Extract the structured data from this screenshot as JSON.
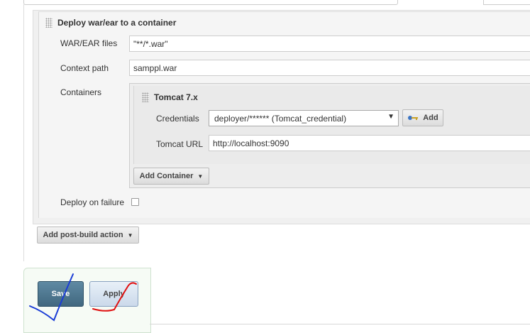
{
  "deploy": {
    "title": "Deploy war/ear to a container",
    "war_label": "WAR/EAR files",
    "war_value": "\"**/*.war\"",
    "context_label": "Context path",
    "context_value": "samppl.war",
    "containers_label": "Containers",
    "deploy_failure_label": "Deploy on failure",
    "deploy_failure_checked": false
  },
  "tomcat": {
    "title": "Tomcat 7.x",
    "credentials_label": "Credentials",
    "credentials_value": "deployer/****** (Tomcat_credential)",
    "add_label": "Add",
    "url_label": "Tomcat URL",
    "url_value": "http://localhost:9090"
  },
  "buttons": {
    "add_container": "Add Container",
    "add_post_build": "Add post-build action",
    "save": "Save",
    "apply": "Apply"
  },
  "icons": {
    "dropdown": "▼",
    "caret": "▼",
    "key": "key-icon"
  },
  "colors": {
    "save_bg": "#4f7791",
    "apply_bg": "#d8e4f1",
    "annotation_blue": "#1a3cd6",
    "annotation_red": "#e01010"
  }
}
